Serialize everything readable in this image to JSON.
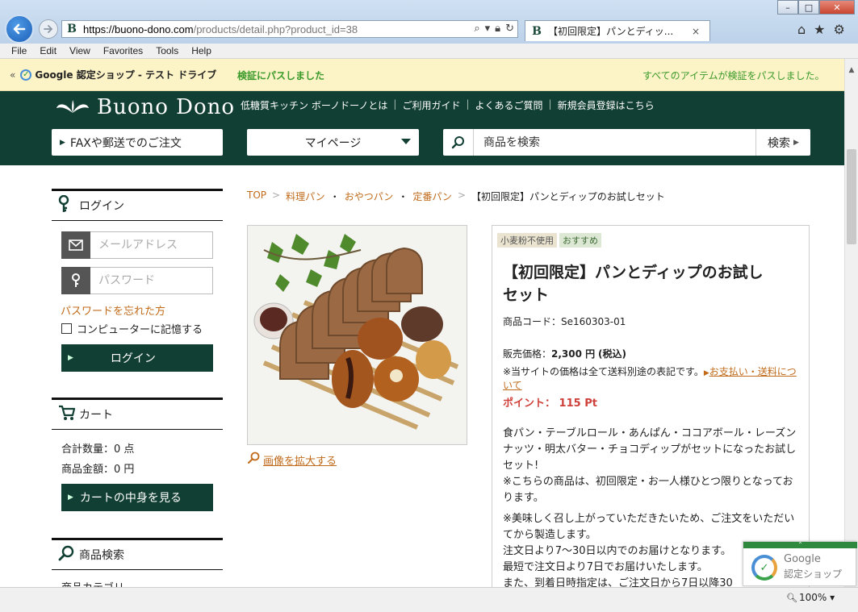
{
  "browser": {
    "url_domain": "https://buono-dono.com",
    "url_rest": "/products/detail.php?product_id=38",
    "tab_title": "【初回限定】パンとディッ...",
    "tab_close": "×",
    "favicon": "B",
    "win_min": "–",
    "win_max": "□",
    "win_close": "✕",
    "menu": [
      "File",
      "Edit",
      "View",
      "Favorites",
      "Tools",
      "Help"
    ],
    "zoom": "100%"
  },
  "google_bar": {
    "chevron": "«",
    "title": "Google 認定ショップ - テスト ドライブ",
    "pass": "検証にパスしました",
    "all_pass": "すべてのアイテムが検証をパスしました。"
  },
  "site": {
    "logo_text": "Buono Dono",
    "head_links": [
      "低糖質キッチン ボーノドーノとは",
      "ご利用ガイド",
      "よくあるご質問",
      "新規会員登録はこちら"
    ],
    "head_sep": "|",
    "fax_label": "FAXや郵送でのご注文",
    "mypage_label": "マイページ",
    "search_placeholder": "商品を検索",
    "search_btn": "検索"
  },
  "sidebar": {
    "login_title": "ログイン",
    "email_placeholder": "メールアドレス",
    "password_placeholder": "パスワード",
    "forgot": "パスワードを忘れた方",
    "remember": "コンピューターに記憶する",
    "login_btn": "ログイン",
    "cart_title": "カート",
    "cart_qty": "合計数量：0 点",
    "cart_amount": "商品金額：0 円",
    "cart_btn": "カートの中身を見る",
    "search_title": "商品検索",
    "search_cat": "商品カテゴリ"
  },
  "breadcrumb": {
    "top": "TOP",
    "gt": ">",
    "dot": "・",
    "items": [
      "料理パン",
      "おやつパン",
      "定番パン"
    ],
    "current": "【初回限定】パンとディップのお試しセット"
  },
  "product": {
    "zoom_link": "画像を拡大する",
    "tags": [
      "小麦粉不使用",
      "おすすめ"
    ],
    "title_line1": "【初回限定】パンとディップのお試し",
    "title_line2": "セット",
    "code": "商品コード：Se160303-01",
    "price_label": "販売価格：",
    "price_value": "2,300 円",
    "price_tax": "(税込)",
    "note": "※当サイトの価格は全て送料別途の表記です。",
    "note_link": "お支払い・送料について",
    "point_label": "ポイント：",
    "point_value": "115 Pt",
    "desc1": "食パン・テーブルロール・あんぱん・ココアボール・レーズンナッツ・明太バター・チョコディップがセットになったお試しセット!",
    "desc2": "※こちらの商品は、初回限定・お一人様ひとつ限りとなっております。",
    "desc3": "※美味しく召し上がっていただきたいため、ご注文をいただいてから製造します。",
    "desc4": "注文日より7〜30日以内でのお届けとなります。",
    "desc5": "最短で注文日より7日でお届けいたします。",
    "desc6": "また、到着日時指定は、ご注文日から7日以降30"
  },
  "google_badge": {
    "line1": "Google",
    "line2": "認定ショップ"
  },
  "icons": {
    "back": "arrow-left-icon",
    "forward": "arrow-right-icon",
    "search": "search-icon",
    "lock": "lock-icon",
    "refresh": "refresh-icon",
    "home": "home-icon",
    "star": "star-icon",
    "gear": "gear-icon",
    "mail": "mail-icon",
    "key": "key-icon",
    "cart": "cart-icon",
    "magnifier": "magnifier-icon"
  },
  "colors": {
    "brand_green": "#123f33",
    "link_orange": "#c06a1a",
    "point_red": "#d0403a",
    "bar_yellow": "#fcf3c6"
  }
}
